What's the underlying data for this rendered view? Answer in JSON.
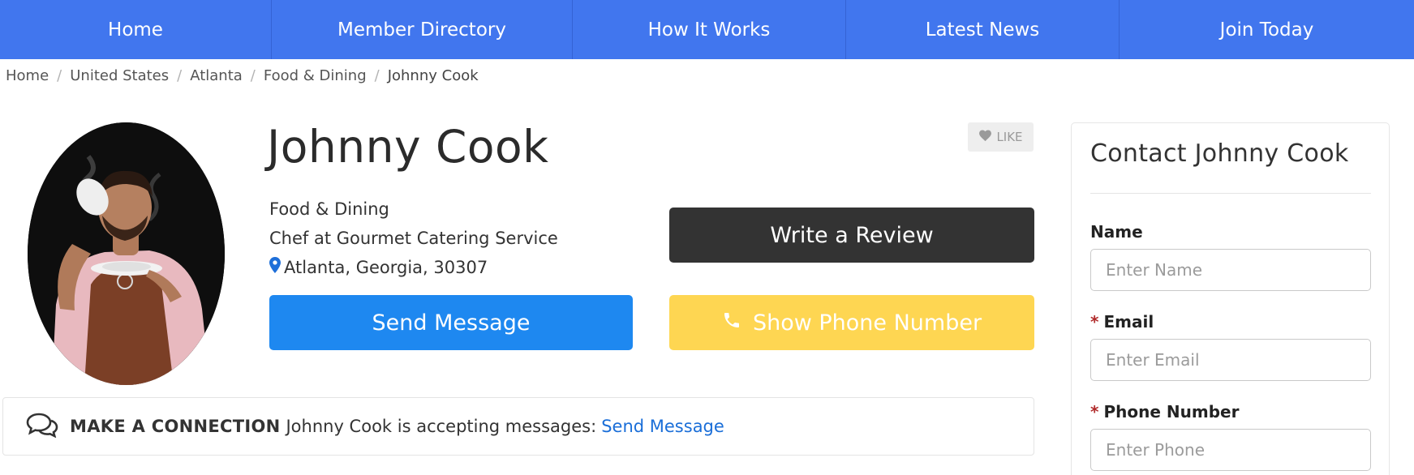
{
  "nav": {
    "items": [
      {
        "label": "Home"
      },
      {
        "label": "Member Directory"
      },
      {
        "label": "How It Works"
      },
      {
        "label": "Latest News"
      },
      {
        "label": "Join Today"
      }
    ]
  },
  "breadcrumb": {
    "items": [
      "Home",
      "United States",
      "Atlanta",
      "Food & Dining"
    ],
    "separator": "/",
    "current": "Johnny Cook"
  },
  "profile": {
    "name": "Johnny Cook",
    "like_label": "LIKE",
    "category": "Food & Dining",
    "title": "Chef at Gourmet Catering Service",
    "location": "Atlanta, Georgia, 30307"
  },
  "actions": {
    "write_review": "Write a Review",
    "send_message": "Send Message",
    "show_phone": "Show Phone Number"
  },
  "connection": {
    "heading": "MAKE A CONNECTION",
    "text": "Johnny Cook is accepting messages:",
    "link": "Send Message"
  },
  "contact": {
    "title": "Contact Johnny Cook",
    "required_marker": "*",
    "fields": {
      "name": {
        "label": "Name",
        "placeholder": "Enter Name"
      },
      "email": {
        "label": "Email",
        "placeholder": "Enter Email"
      },
      "phone": {
        "label": "Phone Number",
        "placeholder": "Enter Phone"
      }
    }
  },
  "colors": {
    "nav_bg": "#4176ee",
    "review_btn": "#333333",
    "message_btn": "#1e88f0",
    "phone_btn": "#fed652",
    "link": "#1a6ed8",
    "required": "#b02a2a",
    "location_icon": "#1e6fd9"
  },
  "icons": {
    "like": "heart-icon",
    "location": "map-marker-icon",
    "phone": "phone-icon",
    "connection": "chat-bubbles-icon"
  }
}
